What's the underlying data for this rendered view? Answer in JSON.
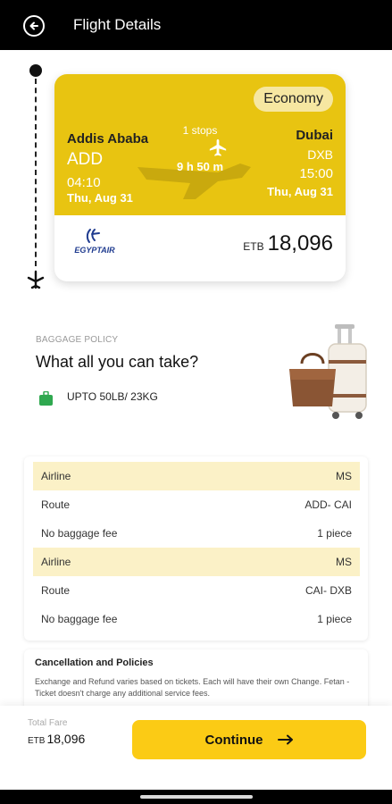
{
  "header": {
    "title": "Flight Details",
    "back_icon": "back-arrow-circle-icon"
  },
  "flight": {
    "class": "Economy",
    "from": {
      "city": "Addis Ababa",
      "code": "ADD",
      "time": "04:10",
      "date": "Thu, Aug 31"
    },
    "to": {
      "city": "Dubai",
      "code": "DXB",
      "time": "15:00",
      "date": "Thu, Aug 31"
    },
    "stops": "1 stops",
    "duration": "9 h 50 m",
    "airline_logo": "egyptair-logo",
    "price": {
      "currency": "ETB",
      "amount": "18,096"
    },
    "accent_color": "#E8C411"
  },
  "baggage": {
    "label": "BAGGAGE POLICY",
    "title": "What all you can take?",
    "allowance": "UPTO 50LB/ 23KG",
    "icon": "luggage-icon",
    "image": "luggage-image"
  },
  "details": {
    "rows": [
      {
        "label": "Airline",
        "value": "MS",
        "highlight": true
      },
      {
        "label": "Route",
        "value": "ADD- CAI",
        "highlight": false
      },
      {
        "label": "No baggage fee",
        "value": "1 piece",
        "highlight": false
      },
      {
        "label": "Airline",
        "value": "MS",
        "highlight": true
      },
      {
        "label": "Route",
        "value": "CAI- DXB",
        "highlight": false
      },
      {
        "label": "No baggage fee",
        "value": "1 piece",
        "highlight": false
      }
    ]
  },
  "policy": {
    "title": "Cancellation and Policies",
    "text": "Exchange and Refund varies based on tickets. Each will have their own Change. Fetan - Ticket doesn't charge any additional service fees."
  },
  "footer": {
    "total_label": "Total Fare",
    "currency": "ETB",
    "amount": "18,096",
    "continue_label": "Continue",
    "button_color": "#FBCB15"
  }
}
